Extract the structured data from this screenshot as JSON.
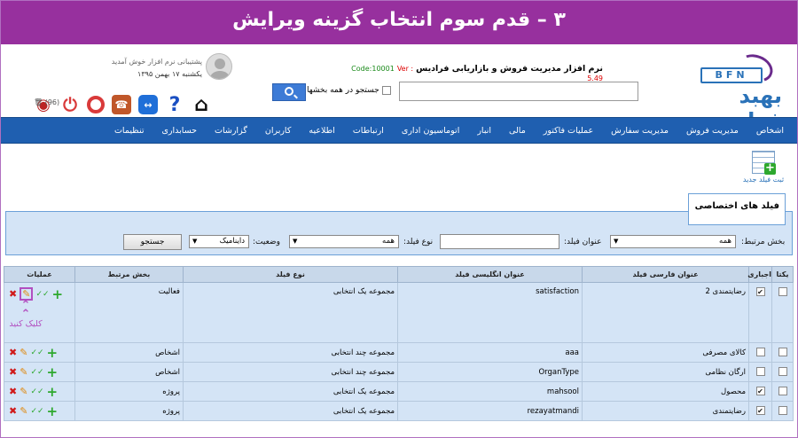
{
  "banner": {
    "title": "۳ – قدم سوم انتخاب گزینه ویرایش"
  },
  "header": {
    "logo_text": "BFN",
    "logo_name": "بهبد فرادیس",
    "app_title": "نرم افزار مدیریت فروش و بازاریابی فرادیس",
    "code": "Code:10001",
    "version": "Ver : 5.49",
    "search_placeholder": "",
    "search_all_label": "جستجو در همه بخشها",
    "welcome": "پشتیبانی نرم افزار خوش آمدید",
    "date": "یکشنبه ۱۷ بهمن ۱۳۹۵",
    "trash_count": "(96)"
  },
  "nav": [
    "اشخاص",
    "مدیریت فروش",
    "مدیریت سفارش",
    "عملیات فاکتور",
    "مالی",
    "انبار",
    "اتوماسیون اداری",
    "ارتباطات",
    "اطلاعیه",
    "کاربران",
    "گزارشات",
    "حسابداری",
    "تنظیمات"
  ],
  "new_field_label": "ثبت فیلد جدید",
  "section_title": "فیلد های اختصاصی",
  "filters": {
    "section_label": "بخش مرتبط:",
    "section_value": "همه",
    "title_label": "عنوان فیلد:",
    "type_label": "نوع فیلد:",
    "type_value": "همه",
    "status_label": "وضعیت:",
    "status_value": "داینامیک",
    "search_button": "جستجو"
  },
  "table": {
    "headers": [
      "یکتا",
      "اجباری",
      "عنوان فارسی فیلد",
      "عنوان انگلیسی فیلد",
      "نوع فیلد",
      "بخش مرتبط",
      "عملیات"
    ],
    "rows": [
      {
        "unique": false,
        "required": true,
        "fa": "رضایتمندی 2",
        "en": "satisfaction",
        "type": "مجموعه یک انتخابی",
        "section": "فعالیت"
      },
      {
        "unique": false,
        "required": false,
        "fa": "کالای مصرفی",
        "en": "aaa",
        "type": "مجموعه چند انتخابی",
        "section": "اشخاص"
      },
      {
        "unique": false,
        "required": false,
        "fa": "ارگان نظامی",
        "en": "OrganType",
        "type": "مجموعه چند انتخابی",
        "section": "اشخاص"
      },
      {
        "unique": false,
        "required": true,
        "fa": "محصول",
        "en": "mahsool",
        "type": "مجموعه یک انتخابی",
        "section": "پروژه"
      },
      {
        "unique": false,
        "required": true,
        "fa": "رضایتمندی",
        "en": "rezayatmandi",
        "type": "مجموعه یک انتخابی",
        "section": "پروژه"
      }
    ]
  },
  "click_hint": "کلیک کنید",
  "colors": {
    "banner": "#97309e",
    "nav": "#1f5fb0",
    "highlight": "#b24fc0"
  }
}
